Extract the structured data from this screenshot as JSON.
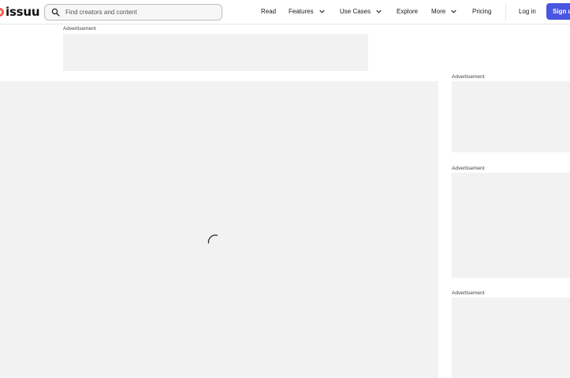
{
  "header": {
    "logo_text": "issuu",
    "search": {
      "placeholder": "Find creators and content",
      "value": ""
    },
    "nav": {
      "read": "Read",
      "features": "Features",
      "use_cases": "Use Cases",
      "explore": "Explore",
      "more": "More",
      "pricing": "Pricing",
      "login": "Log in",
      "signup": "Sign up"
    }
  },
  "ads": {
    "top_label": "Advertisement",
    "side": [
      {
        "label": "Advertisement"
      },
      {
        "label": "Advertisement"
      },
      {
        "label": "Advertisement"
      }
    ]
  },
  "colors": {
    "brand_logo": "#ff5a4e",
    "signup_button": "#4a55e0",
    "placeholder_fill": "#f2f2f2"
  },
  "icons": {
    "search": "search-icon",
    "dropdown": "chevron-down-icon",
    "loading": "loading-spinner-icon"
  }
}
